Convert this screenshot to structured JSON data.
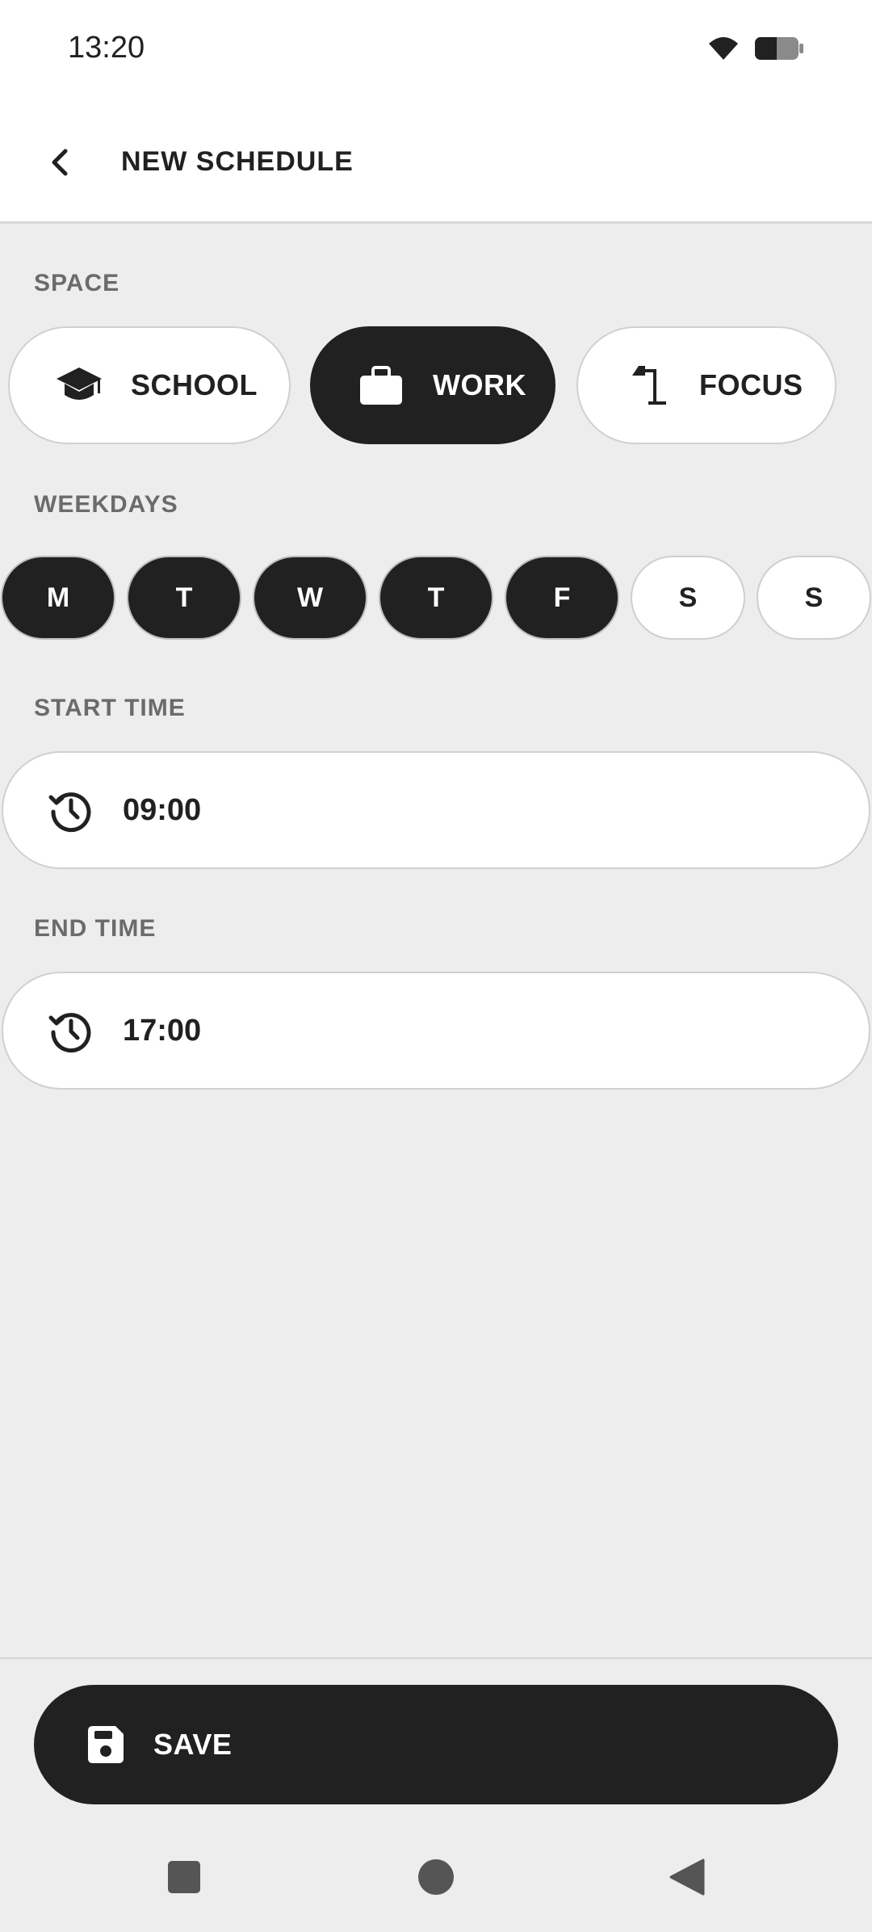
{
  "status_bar": {
    "time": "13:20"
  },
  "header": {
    "title": "NEW SCHEDULE"
  },
  "space": {
    "label": "SPACE",
    "options": [
      {
        "label": "SCHOOL",
        "icon": "graduation-cap-icon",
        "selected": false
      },
      {
        "label": "WORK",
        "icon": "briefcase-icon",
        "selected": true
      },
      {
        "label": "FOCUS",
        "icon": "desk-lamp-icon",
        "selected": false
      }
    ]
  },
  "weekdays": {
    "label": "WEEKDAYS",
    "days": [
      {
        "label": "M",
        "selected": true
      },
      {
        "label": "T",
        "selected": true
      },
      {
        "label": "W",
        "selected": true
      },
      {
        "label": "T",
        "selected": true
      },
      {
        "label": "F",
        "selected": true
      },
      {
        "label": "S",
        "selected": false
      },
      {
        "label": "S",
        "selected": false
      }
    ]
  },
  "start_time": {
    "label": "START TIME",
    "value": "09:00",
    "icon": "history-clock-icon"
  },
  "end_time": {
    "label": "END TIME",
    "value": "17:00",
    "icon": "history-clock-icon"
  },
  "save": {
    "label": "SAVE",
    "icon": "floppy-disk-icon"
  },
  "colors": {
    "accent": "#212121",
    "background": "#ededed",
    "surface": "#ffffff",
    "muted_label": "#6b6b6b"
  }
}
